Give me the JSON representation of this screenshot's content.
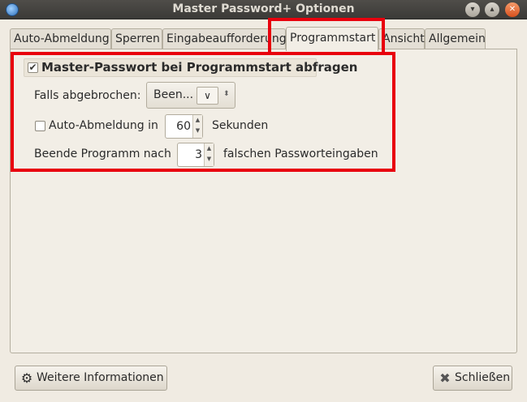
{
  "window": {
    "title": "Master Password+ Optionen",
    "controls": {
      "minimize": "▾",
      "maximize": "▴",
      "close": "✕"
    }
  },
  "tabs": [
    {
      "label": "Auto-Abmeldung"
    },
    {
      "label": "Sperren"
    },
    {
      "label": "Eingabeaufforderung"
    },
    {
      "label": "Programmstart",
      "active": true
    },
    {
      "label": "Ansicht"
    },
    {
      "label": "Allgemein"
    }
  ],
  "startup": {
    "ask_master_password": {
      "label": "Master-Passwort bei Programmstart abfragen",
      "checked": true
    },
    "if_cancelled": {
      "label": "Falls abgebrochen:",
      "value": "Been..."
    },
    "auto_logout": {
      "label": "Auto-Abmeldung in",
      "checked": false,
      "value": "60",
      "unit": "Sekunden"
    },
    "quit_after": {
      "label": "Beende Programm nach",
      "value": "3",
      "unit": "falschen Passworteingaben"
    }
  },
  "footer": {
    "more_info": {
      "label": "Weitere Informationen",
      "icon": "gear-icon"
    },
    "close": {
      "label": "Schließen",
      "icon": "close-x-icon"
    }
  },
  "colors": {
    "highlight": "#e8000d"
  }
}
